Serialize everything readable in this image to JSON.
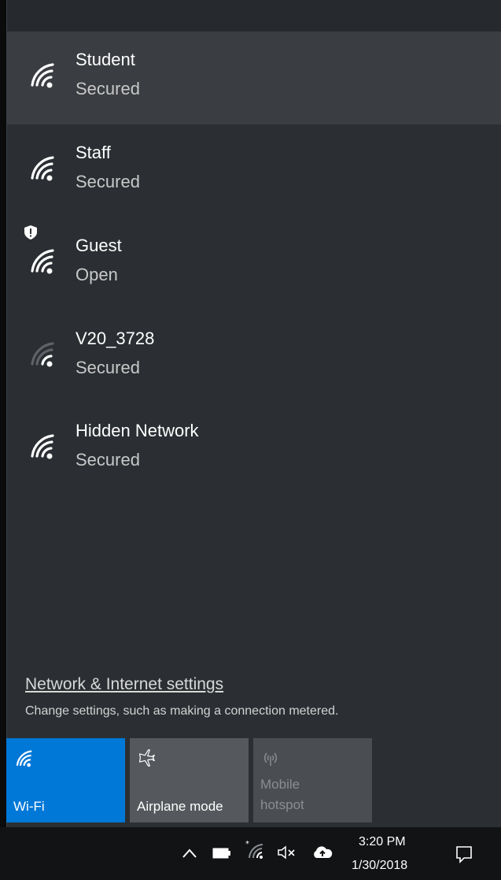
{
  "networks": [
    {
      "name": "Student",
      "status": "Secured",
      "selected": true
    },
    {
      "name": "Staff",
      "status": "Secured"
    },
    {
      "name": "Guest",
      "status": "Open",
      "icon": "wifi-shield-icon"
    },
    {
      "name": "V20_3728",
      "status": "Secured",
      "signal": "weak"
    },
    {
      "name": "Hidden Network",
      "status": "Secured"
    }
  ],
  "settings": {
    "link": "Network & Internet settings",
    "description": "Change settings, such as making a connection metered."
  },
  "tiles": {
    "wifi": {
      "label": "Wi-Fi",
      "icon": "wifi-icon",
      "color": "#0078d7",
      "active": true
    },
    "airplane": {
      "label": "Airplane mode",
      "icon": "airplane-icon"
    },
    "hotspot": {
      "label_line1": "Mobile",
      "label_line2": "hotspot",
      "icon": "hotspot-icon",
      "disabled": true
    }
  },
  "taskbar": {
    "time": "3:20 PM",
    "date": "1/30/2018",
    "tray_icons": [
      "chevron-up-icon",
      "battery-icon",
      "wifi-icon",
      "volume-muted-icon",
      "onedrive-icon",
      "notification-icon"
    ]
  }
}
